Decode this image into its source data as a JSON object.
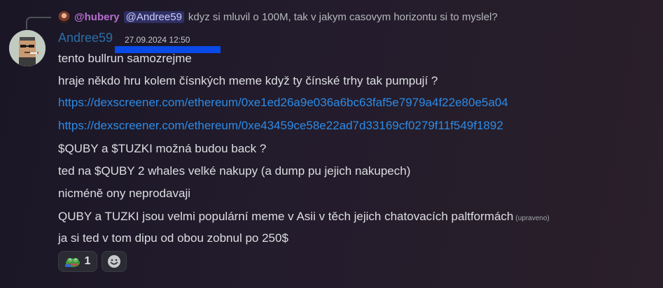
{
  "reply": {
    "author": "@hubery",
    "mention": "@Andree59",
    "text": "kdyz si mluvil o 100M, tak v jakym casovym horizontu si to myslel?"
  },
  "message": {
    "author": "Andree59",
    "timestamp": "27.09.2024 12:50",
    "lines": [
      "tento bullrun samozrejme",
      "hraje někdo hru kolem čísnkých meme když ty čínské trhy tak pumpují ?",
      "https://dexscreener.com/ethereum/0xe1ed26a9e036a6bc63faf5e7979a4f22e80e5a04",
      "https://dexscreener.com/ethereum/0xe43459ce58e22ad7d33169cf0279f11f549f1892",
      "$QUBY a $TUZKI možná budou back ?",
      "ted na $QUBY 2 whales velké nakupy (a dump pu jejich nakupech)",
      "nicméně ony neprodavaji",
      "QUBY a TUZKI jsou velmi populární meme v Asii v těch jejich chatovacích paltformách",
      "ja si ted v tom dipu od obou zobnul po 250$"
    ],
    "edited_label": "(upraveno)"
  },
  "reactions": [
    {
      "icon": "pepe-frog-emoji",
      "count": "1"
    }
  ],
  "add_reaction_icon": "smiley-add-reaction-icon",
  "colors": {
    "author": "#2a6fa8",
    "link": "#2d8be6",
    "reply_author": "#b76ed0",
    "redaction": "#0a4ae8"
  }
}
